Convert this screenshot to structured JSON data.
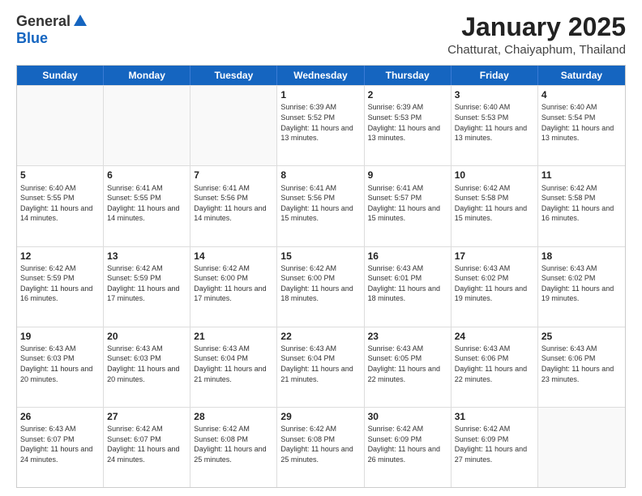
{
  "header": {
    "logo_general": "General",
    "logo_blue": "Blue",
    "month_title": "January 2025",
    "subtitle": "Chatturat, Chaiyaphum, Thailand"
  },
  "weekdays": [
    "Sunday",
    "Monday",
    "Tuesday",
    "Wednesday",
    "Thursday",
    "Friday",
    "Saturday"
  ],
  "weeks": [
    [
      {
        "day": "",
        "sunrise": "",
        "sunset": "",
        "daylight": "",
        "empty": true
      },
      {
        "day": "",
        "sunrise": "",
        "sunset": "",
        "daylight": "",
        "empty": true
      },
      {
        "day": "",
        "sunrise": "",
        "sunset": "",
        "daylight": "",
        "empty": true
      },
      {
        "day": "1",
        "sunrise": "Sunrise: 6:39 AM",
        "sunset": "Sunset: 5:52 PM",
        "daylight": "Daylight: 11 hours and 13 minutes."
      },
      {
        "day": "2",
        "sunrise": "Sunrise: 6:39 AM",
        "sunset": "Sunset: 5:53 PM",
        "daylight": "Daylight: 11 hours and 13 minutes."
      },
      {
        "day": "3",
        "sunrise": "Sunrise: 6:40 AM",
        "sunset": "Sunset: 5:53 PM",
        "daylight": "Daylight: 11 hours and 13 minutes."
      },
      {
        "day": "4",
        "sunrise": "Sunrise: 6:40 AM",
        "sunset": "Sunset: 5:54 PM",
        "daylight": "Daylight: 11 hours and 13 minutes."
      }
    ],
    [
      {
        "day": "5",
        "sunrise": "Sunrise: 6:40 AM",
        "sunset": "Sunset: 5:55 PM",
        "daylight": "Daylight: 11 hours and 14 minutes."
      },
      {
        "day": "6",
        "sunrise": "Sunrise: 6:41 AM",
        "sunset": "Sunset: 5:55 PM",
        "daylight": "Daylight: 11 hours and 14 minutes."
      },
      {
        "day": "7",
        "sunrise": "Sunrise: 6:41 AM",
        "sunset": "Sunset: 5:56 PM",
        "daylight": "Daylight: 11 hours and 14 minutes."
      },
      {
        "day": "8",
        "sunrise": "Sunrise: 6:41 AM",
        "sunset": "Sunset: 5:56 PM",
        "daylight": "Daylight: 11 hours and 15 minutes."
      },
      {
        "day": "9",
        "sunrise": "Sunrise: 6:41 AM",
        "sunset": "Sunset: 5:57 PM",
        "daylight": "Daylight: 11 hours and 15 minutes."
      },
      {
        "day": "10",
        "sunrise": "Sunrise: 6:42 AM",
        "sunset": "Sunset: 5:58 PM",
        "daylight": "Daylight: 11 hours and 15 minutes."
      },
      {
        "day": "11",
        "sunrise": "Sunrise: 6:42 AM",
        "sunset": "Sunset: 5:58 PM",
        "daylight": "Daylight: 11 hours and 16 minutes."
      }
    ],
    [
      {
        "day": "12",
        "sunrise": "Sunrise: 6:42 AM",
        "sunset": "Sunset: 5:59 PM",
        "daylight": "Daylight: 11 hours and 16 minutes."
      },
      {
        "day": "13",
        "sunrise": "Sunrise: 6:42 AM",
        "sunset": "Sunset: 5:59 PM",
        "daylight": "Daylight: 11 hours and 17 minutes."
      },
      {
        "day": "14",
        "sunrise": "Sunrise: 6:42 AM",
        "sunset": "Sunset: 6:00 PM",
        "daylight": "Daylight: 11 hours and 17 minutes."
      },
      {
        "day": "15",
        "sunrise": "Sunrise: 6:42 AM",
        "sunset": "Sunset: 6:00 PM",
        "daylight": "Daylight: 11 hours and 18 minutes."
      },
      {
        "day": "16",
        "sunrise": "Sunrise: 6:43 AM",
        "sunset": "Sunset: 6:01 PM",
        "daylight": "Daylight: 11 hours and 18 minutes."
      },
      {
        "day": "17",
        "sunrise": "Sunrise: 6:43 AM",
        "sunset": "Sunset: 6:02 PM",
        "daylight": "Daylight: 11 hours and 19 minutes."
      },
      {
        "day": "18",
        "sunrise": "Sunrise: 6:43 AM",
        "sunset": "Sunset: 6:02 PM",
        "daylight": "Daylight: 11 hours and 19 minutes."
      }
    ],
    [
      {
        "day": "19",
        "sunrise": "Sunrise: 6:43 AM",
        "sunset": "Sunset: 6:03 PM",
        "daylight": "Daylight: 11 hours and 20 minutes."
      },
      {
        "day": "20",
        "sunrise": "Sunrise: 6:43 AM",
        "sunset": "Sunset: 6:03 PM",
        "daylight": "Daylight: 11 hours and 20 minutes."
      },
      {
        "day": "21",
        "sunrise": "Sunrise: 6:43 AM",
        "sunset": "Sunset: 6:04 PM",
        "daylight": "Daylight: 11 hours and 21 minutes."
      },
      {
        "day": "22",
        "sunrise": "Sunrise: 6:43 AM",
        "sunset": "Sunset: 6:04 PM",
        "daylight": "Daylight: 11 hours and 21 minutes."
      },
      {
        "day": "23",
        "sunrise": "Sunrise: 6:43 AM",
        "sunset": "Sunset: 6:05 PM",
        "daylight": "Daylight: 11 hours and 22 minutes."
      },
      {
        "day": "24",
        "sunrise": "Sunrise: 6:43 AM",
        "sunset": "Sunset: 6:06 PM",
        "daylight": "Daylight: 11 hours and 22 minutes."
      },
      {
        "day": "25",
        "sunrise": "Sunrise: 6:43 AM",
        "sunset": "Sunset: 6:06 PM",
        "daylight": "Daylight: 11 hours and 23 minutes."
      }
    ],
    [
      {
        "day": "26",
        "sunrise": "Sunrise: 6:43 AM",
        "sunset": "Sunset: 6:07 PM",
        "daylight": "Daylight: 11 hours and 24 minutes."
      },
      {
        "day": "27",
        "sunrise": "Sunrise: 6:42 AM",
        "sunset": "Sunset: 6:07 PM",
        "daylight": "Daylight: 11 hours and 24 minutes."
      },
      {
        "day": "28",
        "sunrise": "Sunrise: 6:42 AM",
        "sunset": "Sunset: 6:08 PM",
        "daylight": "Daylight: 11 hours and 25 minutes."
      },
      {
        "day": "29",
        "sunrise": "Sunrise: 6:42 AM",
        "sunset": "Sunset: 6:08 PM",
        "daylight": "Daylight: 11 hours and 25 minutes."
      },
      {
        "day": "30",
        "sunrise": "Sunrise: 6:42 AM",
        "sunset": "Sunset: 6:09 PM",
        "daylight": "Daylight: 11 hours and 26 minutes."
      },
      {
        "day": "31",
        "sunrise": "Sunrise: 6:42 AM",
        "sunset": "Sunset: 6:09 PM",
        "daylight": "Daylight: 11 hours and 27 minutes."
      },
      {
        "day": "",
        "sunrise": "",
        "sunset": "",
        "daylight": "",
        "empty": true
      }
    ]
  ]
}
